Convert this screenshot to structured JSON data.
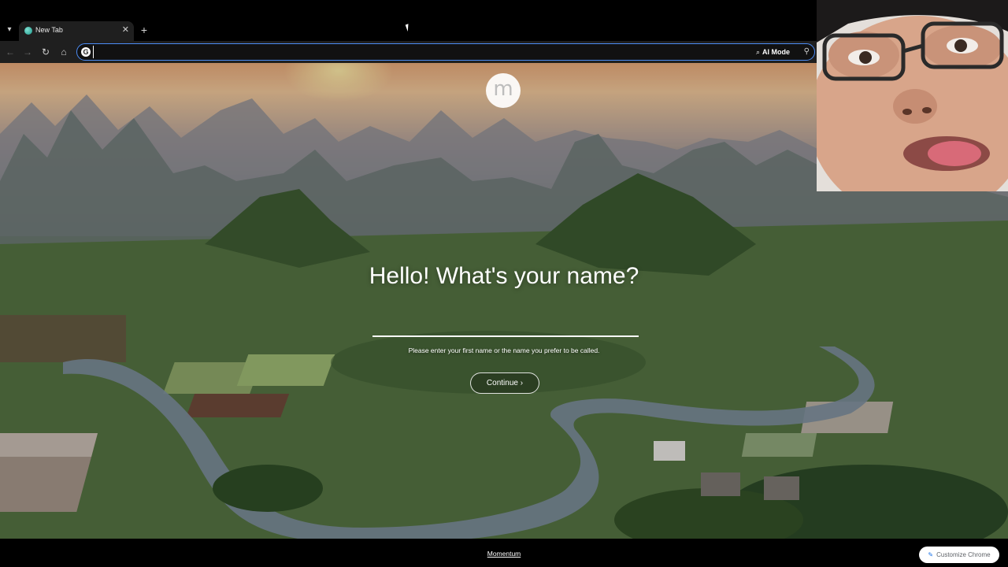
{
  "browser": {
    "tab": {
      "title": "New Tab"
    },
    "omnibox": {
      "value": "",
      "ai_mode_label": "AI Mode"
    }
  },
  "momentum": {
    "logo_letter": "m",
    "greeting": "Hello! What's your name?",
    "name_input_value": "",
    "hint": "Please enter your first name or the name you prefer to be called.",
    "continue_label": "Continue ›",
    "footer_link": "Momentum"
  },
  "chrome_footer": {
    "customize_label": "Customize Chrome"
  },
  "colors": {
    "omnibox_focus": "#4c8cf5",
    "accent": "#1a73e8"
  }
}
